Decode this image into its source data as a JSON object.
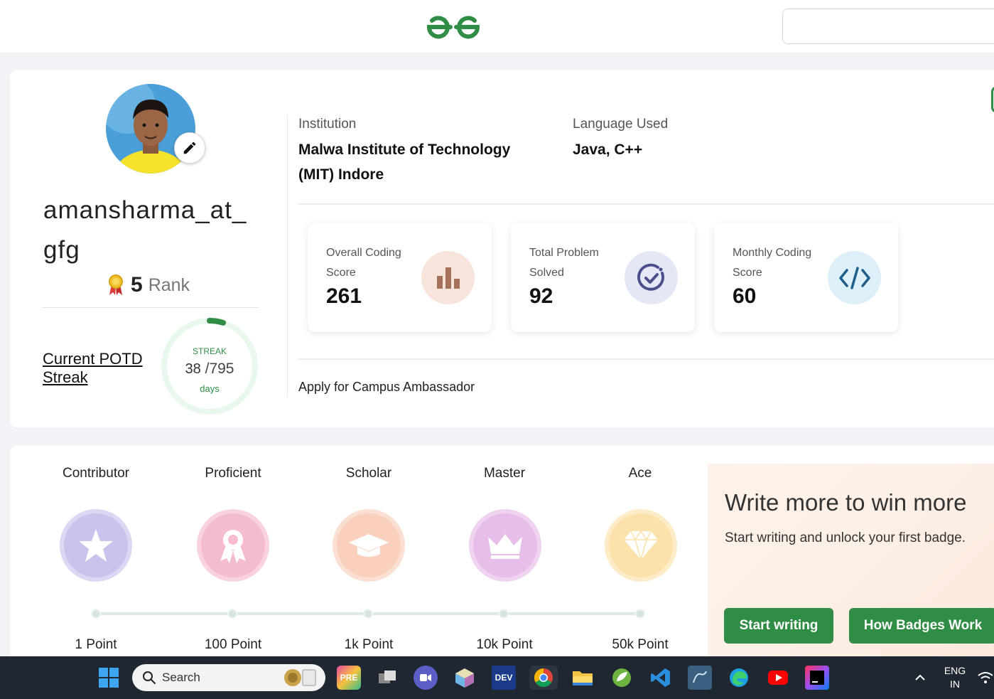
{
  "header": {
    "logo_icon": "gfg-logo-icon",
    "search_value": ""
  },
  "profile": {
    "username": "amansharma_at_gfg",
    "rank_number": "5",
    "rank_label": "Rank",
    "potd_link": "Current POTD Streak",
    "streak": {
      "label": "STREAK",
      "current": "38",
      "total": "/795",
      "unit": "days",
      "progress_fraction": 0.048
    },
    "institution_label": "Institution",
    "institution_value": "Malwa Institute of Technology (MIT) Indore",
    "language_label": "Language Used",
    "language_value": "Java, C++",
    "campus_link": "Apply for Campus Ambassador"
  },
  "stats": [
    {
      "title": "Overall Coding Score",
      "value": "261",
      "icon": "bar-chart-icon"
    },
    {
      "title": "Total Problem Solved",
      "value": "92",
      "icon": "check-circle-icon"
    },
    {
      "title": "Monthly Coding Score",
      "value": "60",
      "icon": "code-icon"
    }
  ],
  "badges": [
    {
      "name": "Contributor",
      "points": "1 Point",
      "icon": "star-icon"
    },
    {
      "name": "Proficient",
      "points": "100 Point",
      "icon": "ribbon-icon"
    },
    {
      "name": "Scholar",
      "points": "1k Point",
      "icon": "graduation-cap-icon"
    },
    {
      "name": "Master",
      "points": "10k Point",
      "icon": "crown-icon"
    },
    {
      "name": "Ace",
      "points": "50k Point",
      "icon": "diamond-icon"
    }
  ],
  "promo": {
    "title": "Write more to win more",
    "subtitle": "Start writing and unlock your first badge.",
    "start_button": "Start writing",
    "badges_button": "How Badges Work"
  },
  "taskbar": {
    "search_label": "Search",
    "lang_line1": "ENG",
    "lang_line2": "IN",
    "dev_label": "DEV"
  },
  "colors": {
    "brand_green": "#2f8d46",
    "taskbar": "#1f2732"
  }
}
